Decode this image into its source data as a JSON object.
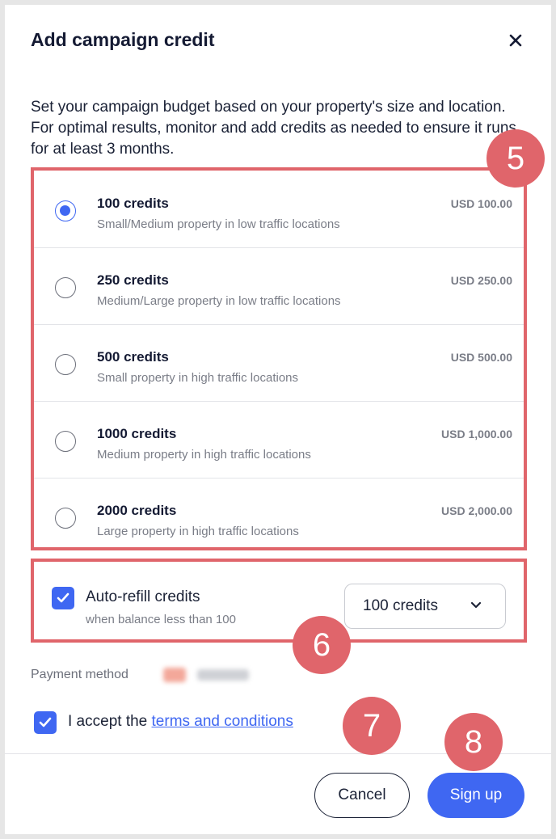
{
  "dialog": {
    "title": "Add campaign credit",
    "intro": "Set your campaign budget based on your property's size and location. For optimal results, monitor and add credits as needed to ensure it runs for at least 3 months."
  },
  "options": [
    {
      "name": "100 credits",
      "desc": "Small/Medium property in low traffic locations",
      "price": "USD 100.00",
      "selected": true
    },
    {
      "name": "250 credits",
      "desc": "Medium/Large property in low traffic locations",
      "price": "USD 250.00",
      "selected": false
    },
    {
      "name": "500 credits",
      "desc": "Small property in high traffic locations",
      "price": "USD 500.00",
      "selected": false
    },
    {
      "name": "1000 credits",
      "desc": "Medium property in high traffic locations",
      "price": "USD 1,000.00",
      "selected": false
    },
    {
      "name": "2000 credits",
      "desc": "Large property in high traffic locations",
      "price": "USD 2,000.00",
      "selected": false
    }
  ],
  "refill": {
    "label": "Auto-refill credits",
    "sub": "when balance less than 100",
    "checked": true,
    "amount": "100 credits"
  },
  "payment": {
    "label": "Payment method"
  },
  "terms": {
    "prefix": "I accept the",
    "link": "terms and conditions",
    "checked": true
  },
  "footer": {
    "cancel": "Cancel",
    "signup": "Sign up"
  },
  "annotations": [
    "5",
    "6",
    "7",
    "8"
  ],
  "colors": {
    "accent": "#3f67f2",
    "annotation": "#e0656b",
    "text": "#1b2236",
    "muted": "#7a7d87"
  }
}
